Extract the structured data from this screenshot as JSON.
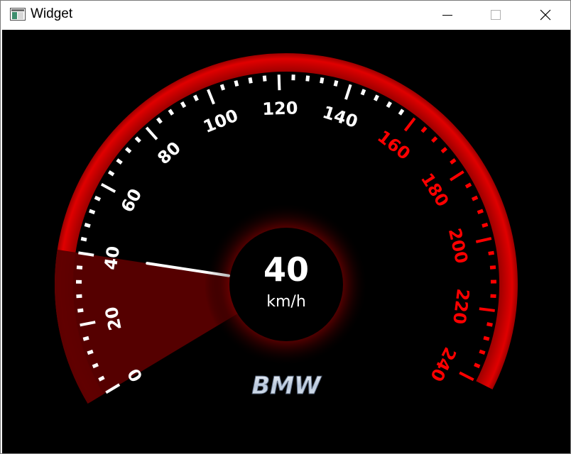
{
  "window": {
    "title": "Widget"
  },
  "colors": {
    "background": "#000000",
    "rim": "#c00000",
    "tick_normal": "#ffffff",
    "tick_warning": "#ff0000",
    "needle": "#ffffff",
    "sector": "#5a0000",
    "brand": "#c8d4e6"
  },
  "gauge": {
    "speed": "40",
    "unit": "km/h",
    "brand": "BMW",
    "min": 0,
    "max": 240,
    "warning_from": 160,
    "major_step": 20,
    "minor_per_major": 5,
    "value": 40,
    "labels": [
      "0",
      "20",
      "40",
      "60",
      "80",
      "100",
      "120",
      "140",
      "160",
      "180",
      "200",
      "220",
      "240"
    ]
  }
}
